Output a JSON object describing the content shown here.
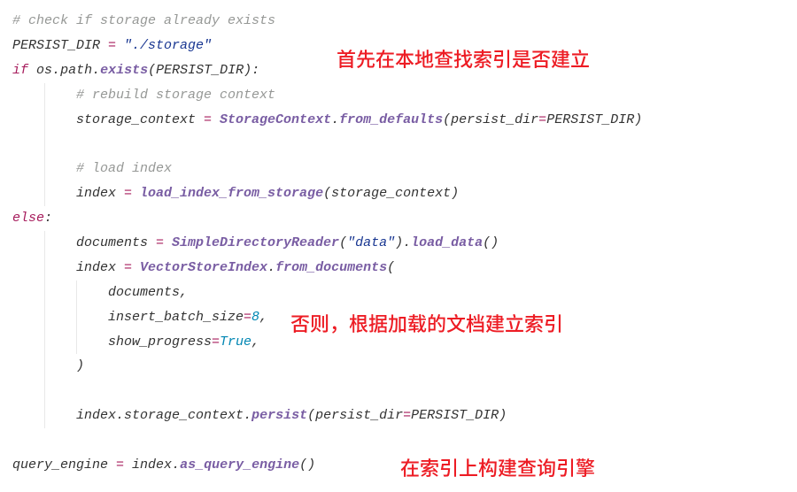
{
  "annotations": {
    "a1": "首先在本地查找索引是否建立",
    "a2": "否则，根据加载的文档建立索引",
    "a3": "在索引上构建查询引擎"
  },
  "code": {
    "l1_comment": "# check if storage already exists",
    "l2_var": "PERSIST_DIR",
    "l2_eq": " = ",
    "l2_str": "\"./storage\"",
    "l3_if": "if",
    "l3_os": "os",
    "l3_dot1": ".",
    "l3_path": "path",
    "l3_dot2": ".",
    "l3_exists": "exists",
    "l3_open": "(",
    "l3_arg": "PERSIST_DIR",
    "l3_close": "):",
    "l4_comment": "# rebuild storage context",
    "l5_var": "storage_context",
    "l5_eq": " = ",
    "l5_cls": "StorageContext",
    "l5_dot": ".",
    "l5_fn": "from_defaults",
    "l5_open": "(",
    "l5_kw": "persist_dir",
    "l5_eq2": "=",
    "l5_val": "PERSIST_DIR",
    "l5_close": ")",
    "l7_comment": "# load index",
    "l8_var": "index",
    "l8_eq": " = ",
    "l8_fn": "load_index_from_storage",
    "l8_open": "(",
    "l8_arg": "storage_context",
    "l8_close": ")",
    "l9_else": "else",
    "l9_colon": ":",
    "l10_var": "documents",
    "l10_eq": " = ",
    "l10_cls": "SimpleDirectoryReader",
    "l10_open": "(",
    "l10_arg": "\"data\"",
    "l10_close": ").",
    "l10_fn": "load_data",
    "l10_p": "()",
    "l11_var": "index",
    "l11_eq": " = ",
    "l11_cls": "VectorStoreIndex",
    "l11_dot": ".",
    "l11_fn": "from_documents",
    "l11_open": "(",
    "l12_arg": "documents",
    "l12_comma": ",",
    "l13_kw": "insert_batch_size",
    "l13_eq": "=",
    "l13_val": "8",
    "l13_comma": ",",
    "l14_kw": "show_progress",
    "l14_eq": "=",
    "l14_val": "True",
    "l14_comma": ",",
    "l15_close": ")",
    "l17_var": "index",
    "l17_dot1": ".",
    "l17_attr": "storage_context",
    "l17_dot2": ".",
    "l17_fn": "persist",
    "l17_open": "(",
    "l17_kw": "persist_dir",
    "l17_eq": "=",
    "l17_val": "PERSIST_DIR",
    "l17_close": ")",
    "l19_var": "query_engine",
    "l19_eq": " = ",
    "l19_obj": "index",
    "l19_dot": ".",
    "l19_fn": "as_query_engine",
    "l19_p": "()"
  }
}
